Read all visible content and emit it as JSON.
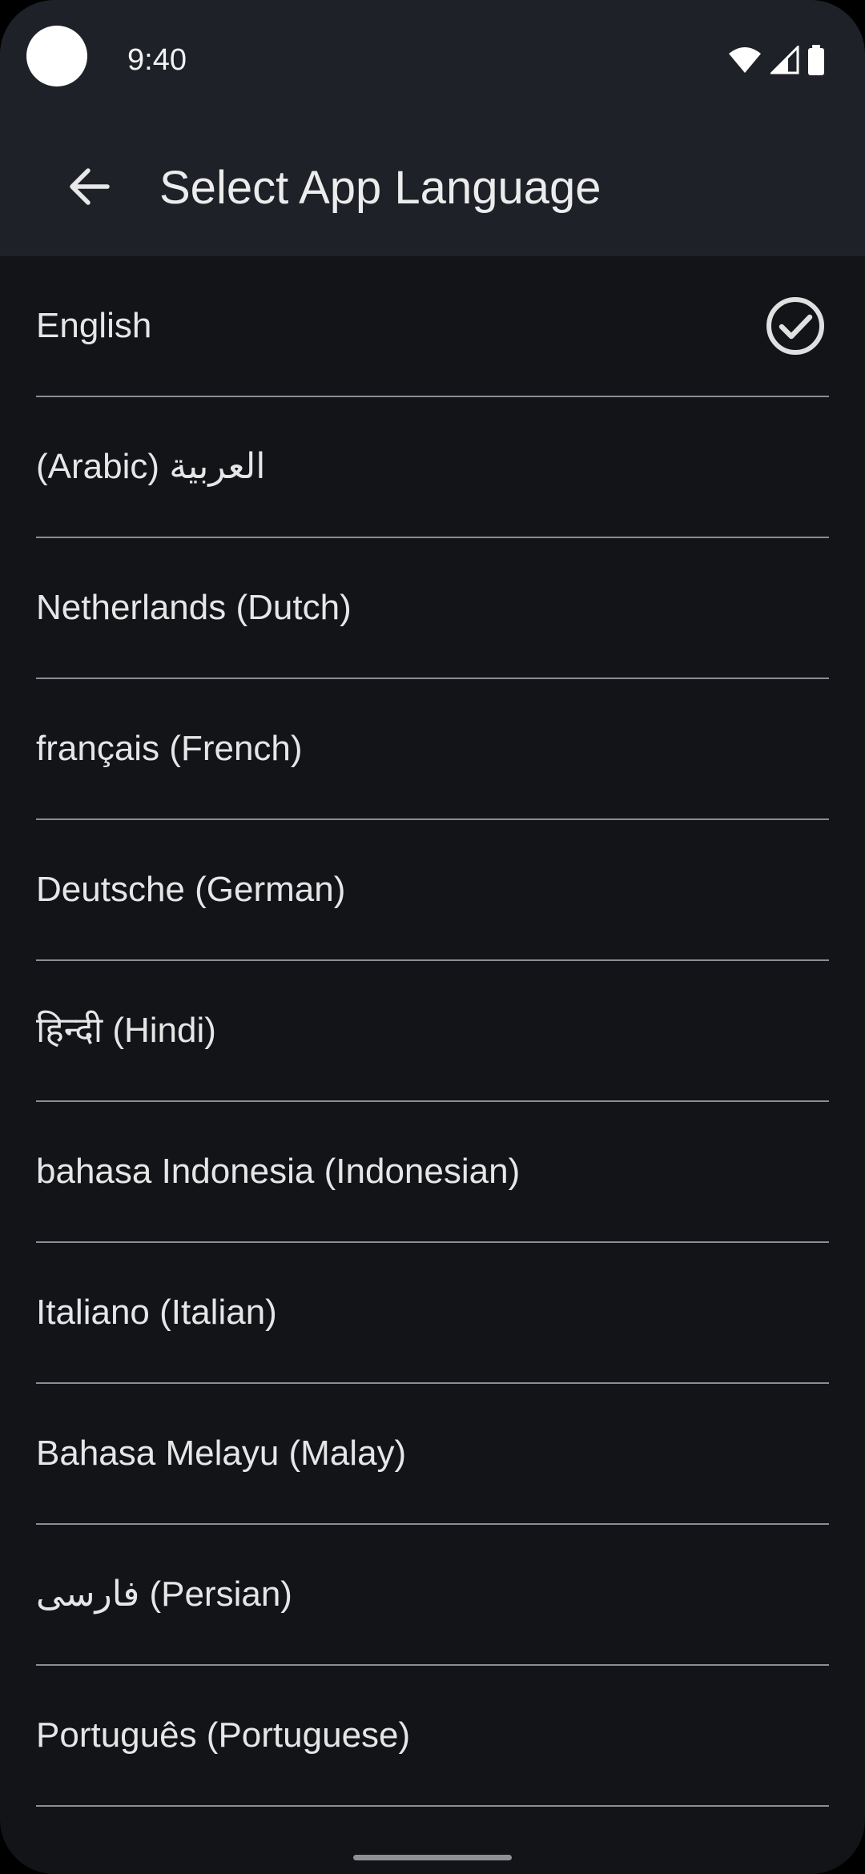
{
  "status_bar": {
    "time": "9:40",
    "icons": [
      "wifi-icon",
      "cell-signal-icon",
      "battery-icon"
    ]
  },
  "app_bar": {
    "back_icon": "arrow-left-icon",
    "title": "Select App Language"
  },
  "languages": [
    {
      "label": "English",
      "selected": true
    },
    {
      "label": "(Arabic) العربية",
      "selected": false
    },
    {
      "label": "Netherlands (Dutch)",
      "selected": false
    },
    {
      "label": "français (French)",
      "selected": false
    },
    {
      "label": "Deutsche (German)",
      "selected": false
    },
    {
      "label": "हिन्दी (Hindi)",
      "selected": false
    },
    {
      "label": "bahasa Indonesia (Indonesian)",
      "selected": false
    },
    {
      "label": "Italiano (Italian)",
      "selected": false
    },
    {
      "label": "Bahasa Melayu (Malay)",
      "selected": false
    },
    {
      "label": "فارسی (Persian)",
      "selected": false
    },
    {
      "label": "Português (Portuguese)",
      "selected": false
    }
  ],
  "colors": {
    "background": "#121418",
    "app_bar": "#1e2128",
    "text": "#e6e6e6",
    "divider": "#8a8d93",
    "check": "#e0e0e0"
  }
}
